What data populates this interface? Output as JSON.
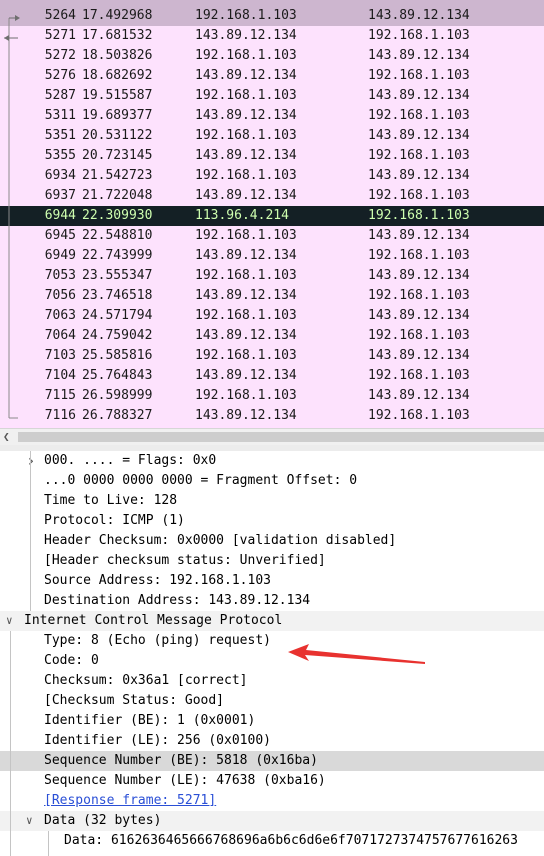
{
  "packet_list": {
    "rows": [
      {
        "no": "5264",
        "time": "17.492968",
        "src": "192.168.1.103",
        "dst": "143.89.12.134",
        "style": "sel-related"
      },
      {
        "no": "5271",
        "time": "17.681532",
        "src": "143.89.12.134",
        "dst": "192.168.1.103",
        "style": "normal"
      },
      {
        "no": "5272",
        "time": "18.503826",
        "src": "192.168.1.103",
        "dst": "143.89.12.134",
        "style": "normal"
      },
      {
        "no": "5276",
        "time": "18.682692",
        "src": "143.89.12.134",
        "dst": "192.168.1.103",
        "style": "normal"
      },
      {
        "no": "5287",
        "time": "19.515587",
        "src": "192.168.1.103",
        "dst": "143.89.12.134",
        "style": "normal"
      },
      {
        "no": "5311",
        "time": "19.689377",
        "src": "143.89.12.134",
        "dst": "192.168.1.103",
        "style": "normal"
      },
      {
        "no": "5351",
        "time": "20.531122",
        "src": "192.168.1.103",
        "dst": "143.89.12.134",
        "style": "normal"
      },
      {
        "no": "5355",
        "time": "20.723145",
        "src": "143.89.12.134",
        "dst": "192.168.1.103",
        "style": "normal"
      },
      {
        "no": "6934",
        "time": "21.542723",
        "src": "192.168.1.103",
        "dst": "143.89.12.134",
        "style": "normal"
      },
      {
        "no": "6937",
        "time": "21.722048",
        "src": "143.89.12.134",
        "dst": "192.168.1.103",
        "style": "normal"
      },
      {
        "no": "6944",
        "time": "22.309930",
        "src": "113.96.4.214",
        "dst": "192.168.1.103",
        "style": "selected"
      },
      {
        "no": "6945",
        "time": "22.548810",
        "src": "192.168.1.103",
        "dst": "143.89.12.134",
        "style": "normal"
      },
      {
        "no": "6949",
        "time": "22.743999",
        "src": "143.89.12.134",
        "dst": "192.168.1.103",
        "style": "normal"
      },
      {
        "no": "7053",
        "time": "23.555347",
        "src": "192.168.1.103",
        "dst": "143.89.12.134",
        "style": "normal"
      },
      {
        "no": "7056",
        "time": "23.746518",
        "src": "143.89.12.134",
        "dst": "192.168.1.103",
        "style": "normal"
      },
      {
        "no": "7063",
        "time": "24.571794",
        "src": "192.168.1.103",
        "dst": "143.89.12.134",
        "style": "normal"
      },
      {
        "no": "7064",
        "time": "24.759042",
        "src": "143.89.12.134",
        "dst": "192.168.1.103",
        "style": "normal"
      },
      {
        "no": "7103",
        "time": "25.585816",
        "src": "192.168.1.103",
        "dst": "143.89.12.134",
        "style": "normal"
      },
      {
        "no": "7104",
        "time": "25.764843",
        "src": "143.89.12.134",
        "dst": "192.168.1.103",
        "style": "normal"
      },
      {
        "no": "7115",
        "time": "26.598999",
        "src": "192.168.1.103",
        "dst": "143.89.12.134",
        "style": "normal"
      },
      {
        "no": "7116",
        "time": "26.788327",
        "src": "143.89.12.134",
        "dst": "192.168.1.103",
        "style": "normal"
      }
    ]
  },
  "details": {
    "rows": [
      {
        "text": "000. .... = Flags: 0x0",
        "level": 2,
        "toggle": "collapsed",
        "style": ""
      },
      {
        "text": "...0 0000 0000 0000 = Fragment Offset: 0",
        "level": 2,
        "toggle": "",
        "style": ""
      },
      {
        "text": "Time to Live: 128",
        "level": 2,
        "toggle": "",
        "style": ""
      },
      {
        "text": "Protocol: ICMP (1)",
        "level": 2,
        "toggle": "",
        "style": ""
      },
      {
        "text": "Header Checksum: 0x0000 [validation disabled]",
        "level": 2,
        "toggle": "",
        "style": ""
      },
      {
        "text": "[Header checksum status: Unverified]",
        "level": 2,
        "toggle": "",
        "style": ""
      },
      {
        "text": "Source Address: 192.168.1.103",
        "level": 2,
        "toggle": "",
        "style": ""
      },
      {
        "text": "Destination Address: 143.89.12.134",
        "level": 2,
        "toggle": "",
        "style": ""
      },
      {
        "text": "Internet Control Message Protocol",
        "level": 1,
        "toggle": "expanded",
        "style": "alt"
      },
      {
        "text": "Type: 8 (Echo (ping) request)",
        "level": 2,
        "toggle": "",
        "style": ""
      },
      {
        "text": "Code: 0",
        "level": 2,
        "toggle": "",
        "style": ""
      },
      {
        "text": "Checksum: 0x36a1 [correct]",
        "level": 2,
        "toggle": "",
        "style": ""
      },
      {
        "text": "[Checksum Status: Good]",
        "level": 2,
        "toggle": "",
        "style": ""
      },
      {
        "text": "Identifier (BE): 1 (0x0001)",
        "level": 2,
        "toggle": "",
        "style": ""
      },
      {
        "text": "Identifier (LE): 256 (0x0100)",
        "level": 2,
        "toggle": "",
        "style": ""
      },
      {
        "text": "Sequence Number (BE): 5818 (0x16ba)",
        "level": 2,
        "toggle": "",
        "style": "hl"
      },
      {
        "text": "Sequence Number (LE): 47638 (0xba16)",
        "level": 2,
        "toggle": "",
        "style": ""
      },
      {
        "text": "[Response frame: 5271]",
        "level": 2,
        "toggle": "",
        "style": "link"
      },
      {
        "text": "Data (32 bytes)",
        "level": 2,
        "toggle": "expanded",
        "style": "alt"
      },
      {
        "text": "Data: 6162636465666768696a6b6c6d6e6f7071727374757677616263",
        "level": 3,
        "toggle": "",
        "style": ""
      }
    ]
  },
  "colors": {
    "row_normal_bg": "#fde2fd",
    "row_selected_bg": "#142025",
    "row_selected_fg": "#cfffb0",
    "row_related_bg": "#cdb6cf",
    "annotation_arrow": "#e8322f",
    "link": "#2a4fd6"
  },
  "icons": {
    "collapsed": "chevron-right-icon",
    "expanded": "chevron-down-icon",
    "scroll_left": "scroll-left-arrow-icon"
  }
}
